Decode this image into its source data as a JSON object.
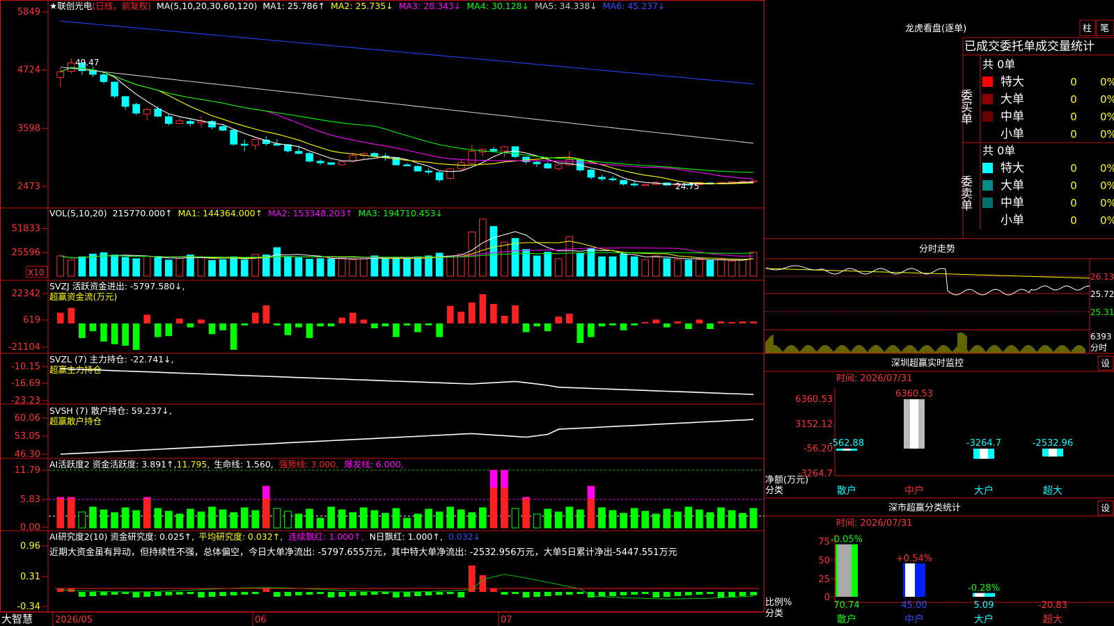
{
  "chart_header": {
    "star": "★",
    "stock_name": "联创光电",
    "period_note": "(日线，前复权)",
    "ma_prefix": "MA(5,10,20,30,60,120)",
    "ma1": "MA1: 25.786↑",
    "ma2": "MA2: 25.735↓",
    "ma3": "MA3: 28.343↓",
    "ma4": "MA4: 30.128↓",
    "ma5": "MA5: 34.338↓",
    "ma6": "MA6: 45.237↓"
  },
  "price_axis": [
    "5849",
    "4724",
    "3598",
    "2473"
  ],
  "price_annotations": {
    "high": "49.47",
    "low": "24.75"
  },
  "vol_header": {
    "prefix": "VOL(5,10,20)",
    "value": "215770.000↑",
    "ma1": "MA1: 144364.000↑",
    "ma2": "MA2: 153348.203↑",
    "ma3": "MA3: 194710.453↓"
  },
  "vol_axis": [
    "51833",
    "25596"
  ],
  "vol_unit": "X10",
  "svzj": {
    "title": "SVZJ  活跃资金进出: -5797.580↓,",
    "subtitle": "超赢资金流(万元)",
    "axis": [
      "22342",
      "619",
      "-21104"
    ]
  },
  "svzl": {
    "title": "SVZL (7) 主力持仓: -22.741↓,",
    "subtitle": "超赢主力持仓",
    "axis": [
      "-10.15",
      "-16.69",
      "-23.23"
    ]
  },
  "svsh": {
    "title": "SVSH (7) 散户持仓: 59.237↓,",
    "subtitle": "超赢散户持仓",
    "axis": [
      "60.06",
      "53.05",
      "46.30"
    ]
  },
  "ai_active": {
    "title": "AI活跃度2 资金活跃度: 3.891↑,",
    "v2": "11.795,",
    "v3": "生命线: 1.560,",
    "v4": "强势线: 3.000,",
    "v5": "爆发线: 6.000,",
    "axis": [
      "11.79",
      "5.83",
      "0.00"
    ]
  },
  "ai_research": {
    "title": "AI研究度2(10) 资金研究度: 0.025↑,",
    "v2": "平均研究度: 0.032↑,",
    "v3": "连续飘红: 1.000↑,",
    "v4": "N日飘红: 1.000↑,",
    "v5": "0.032↓",
    "comment": "近期大资金虽有异动，但持续性不强，总体偏空，今日大单净流出: -5797.655万元，其中特大单净流出: -2532.956万元，大单5日累计净出-5447.551万元",
    "axis": [
      "0.96",
      "0.31",
      "-0.34"
    ]
  },
  "bottom_axis": {
    "brand": "大智慧",
    "d1": "2026/05",
    "d2": "06",
    "d3": "07"
  },
  "dragon": {
    "title": "龙虎看盘(逐单)",
    "btn1": "柱",
    "btn2": "笔",
    "header": "已成交委托单成交量统计",
    "buy_label": "委买单",
    "sell_label": "委卖单",
    "buy_total": "共 0单",
    "sell_total": "共 0单",
    "buy_rows": [
      {
        "name": "特大",
        "count": "0",
        "pct": "0%",
        "color": "#ff0000"
      },
      {
        "name": "大单",
        "count": "0",
        "pct": "0%",
        "color": "#8b0000"
      },
      {
        "name": "中单",
        "count": "0",
        "pct": "0%",
        "color": "#6a0000"
      },
      {
        "name": "小单",
        "count": "0",
        "pct": "0%",
        "color": ""
      }
    ],
    "sell_rows": [
      {
        "name": "特大",
        "count": "0",
        "pct": "0%",
        "color": "#00ffff"
      },
      {
        "name": "大单",
        "count": "0",
        "pct": "0%",
        "color": "#008b8b"
      },
      {
        "name": "中单",
        "count": "0",
        "pct": "0%",
        "color": "#006f6f"
      },
      {
        "name": "小单",
        "count": "0",
        "pct": "0%",
        "color": ""
      }
    ]
  },
  "intraday": {
    "title": "分时走势",
    "axis": [
      "26.13",
      "25.72",
      "25.31"
    ],
    "vol_label": "6393",
    "vol_unit": "分时"
  },
  "monitor": {
    "title": "深圳超赢实时监控",
    "btn": "设",
    "time": "时间: 2026/07/31",
    "axis": [
      "6360.53",
      "3152.12",
      "-56.20",
      "-3264.7"
    ],
    "ylabel": "净额(万元)",
    "xlabel": "分类",
    "categories": [
      "散户",
      "中户",
      "大户",
      "超大"
    ],
    "values": [
      -562.88,
      6360.53,
      -3264.7,
      -2532.96
    ],
    "labels": [
      "-562.88",
      "6360.53",
      "-3264.7",
      "-2532.96"
    ]
  },
  "classify": {
    "title": "深市超赢分类统计",
    "btn": "设",
    "time": "时间: 2026/07/31",
    "axis": [
      "75",
      "50",
      "25",
      "0"
    ],
    "ylabel": "比例%",
    "xlabel": "分类",
    "categories": [
      "散户",
      "中户",
      "大户",
      "超大"
    ],
    "values": [
      70.74,
      45.0,
      5.09,
      -20.83
    ],
    "bottom_labels": [
      "70.74",
      "45.00",
      "5.09",
      "-20.83"
    ],
    "top_labels": [
      "-0.05%",
      "+0.54%",
      "-0.28%",
      ""
    ]
  },
  "chart_data": {
    "type": "candlestick",
    "ohlc": [
      [
        45.8,
        47.6,
        43.9,
        46.9
      ],
      [
        47.0,
        49.5,
        46.6,
        48.6
      ],
      [
        48.6,
        48.8,
        46.3,
        47.1
      ],
      [
        47.2,
        47.9,
        45.9,
        46.4
      ],
      [
        46.3,
        46.9,
        44.6,
        45.0
      ],
      [
        44.9,
        45.0,
        41.8,
        42.2
      ],
      [
        42.1,
        42.2,
        39.5,
        40.2
      ],
      [
        40.6,
        40.9,
        38.5,
        38.9
      ],
      [
        38.7,
        39.9,
        37.5,
        39.6
      ],
      [
        39.7,
        40.3,
        38.1,
        38.3
      ],
      [
        38.2,
        38.8,
        36.5,
        36.9
      ],
      [
        36.9,
        37.9,
        36.8,
        37.4
      ],
      [
        37.3,
        37.9,
        36.4,
        36.9
      ],
      [
        37.0,
        38.4,
        36.1,
        37.4
      ],
      [
        37.3,
        37.6,
        35.8,
        36.2
      ],
      [
        36.3,
        36.8,
        35.4,
        35.6
      ],
      [
        35.6,
        35.8,
        32.6,
        32.9
      ],
      [
        32.9,
        33.8,
        31.5,
        32.7
      ],
      [
        32.7,
        33.9,
        31.8,
        33.8
      ],
      [
        33.7,
        34.4,
        32.6,
        33.0
      ],
      [
        32.9,
        33.9,
        32.6,
        32.7
      ],
      [
        32.8,
        32.9,
        31.3,
        31.6
      ],
      [
        31.5,
        32.6,
        30.9,
        31.1
      ],
      [
        31.1,
        31.4,
        29.4,
        29.6
      ],
      [
        29.6,
        30.0,
        28.9,
        29.3
      ],
      [
        29.3,
        29.4,
        28.9,
        29.0
      ],
      [
        28.9,
        29.7,
        28.8,
        29.5
      ],
      [
        29.6,
        31.3,
        29.4,
        30.7
      ],
      [
        30.7,
        31.3,
        30.1,
        31.1
      ],
      [
        31.1,
        31.4,
        30.4,
        30.6
      ],
      [
        30.6,
        31.1,
        29.7,
        30.3
      ],
      [
        30.3,
        30.4,
        28.8,
        28.9
      ],
      [
        28.9,
        29.2,
        28.6,
        28.7
      ],
      [
        28.6,
        28.8,
        27.6,
        27.7
      ],
      [
        27.7,
        28.2,
        27.1,
        27.5
      ],
      [
        27.4,
        27.6,
        25.6,
        26.0
      ],
      [
        26.3,
        28.3,
        26.1,
        28.1
      ],
      [
        28.1,
        30.0,
        27.6,
        29.3
      ],
      [
        29.2,
        32.8,
        28.9,
        31.5
      ],
      [
        31.4,
        32.1,
        30.5,
        31.9
      ],
      [
        31.9,
        32.4,
        31.4,
        31.6
      ],
      [
        31.6,
        32.6,
        30.4,
        32.4
      ],
      [
        32.4,
        32.5,
        30.2,
        30.5
      ],
      [
        30.4,
        30.5,
        29.1,
        29.5
      ],
      [
        29.4,
        29.7,
        28.5,
        29.1
      ],
      [
        29.1,
        29.5,
        28.1,
        28.3
      ],
      [
        28.2,
        29.1,
        27.8,
        28.9
      ],
      [
        28.9,
        31.6,
        28.7,
        29.9
      ],
      [
        29.9,
        30.1,
        27.6,
        27.9
      ],
      [
        27.9,
        28.1,
        26.1,
        26.5
      ],
      [
        26.5,
        27.0,
        25.8,
        26.2
      ],
      [
        26.2,
        26.7,
        25.7,
        26.0
      ],
      [
        25.9,
        26.0,
        24.9,
        25.2
      ],
      [
        25.2,
        25.7,
        24.7,
        25.0
      ],
      [
        25.0,
        25.2,
        24.8,
        25.1
      ],
      [
        25.1,
        25.7,
        24.9,
        25.5
      ],
      [
        25.4,
        25.5,
        24.8,
        25.0
      ],
      [
        25.0,
        25.3,
        24.9,
        25.2
      ],
      [
        25.2,
        25.3,
        25.0,
        25.1
      ],
      [
        25.1,
        25.6,
        25.0,
        25.5
      ],
      [
        25.4,
        25.6,
        25.1,
        25.3
      ],
      [
        25.3,
        25.6,
        25.2,
        25.5
      ],
      [
        25.5,
        25.7,
        25.3,
        25.6
      ],
      [
        25.5,
        25.7,
        25.3,
        25.7
      ],
      [
        25.6,
        25.9,
        25.5,
        25.8
      ]
    ],
    "volume": [
      22000,
      17500,
      21000,
      24000,
      25500,
      23000,
      20500,
      19000,
      21500,
      20000,
      17500,
      19500,
      23000,
      20500,
      17000,
      18000,
      21000,
      17500,
      23500,
      23000,
      31000,
      20500,
      20000,
      18500,
      19000,
      18500,
      19500,
      18000,
      19000,
      22000,
      19000,
      20000,
      19000,
      21000,
      22000,
      25000,
      22000,
      24000,
      48000,
      62000,
      54000,
      37000,
      41000,
      29000,
      22000,
      26000,
      19000,
      43000,
      25000,
      30000,
      21000,
      21000,
      24000,
      21000,
      18000,
      22000,
      19000,
      18000,
      17500,
      18000,
      17000,
      18000,
      16500,
      17500,
      26000
    ]
  }
}
